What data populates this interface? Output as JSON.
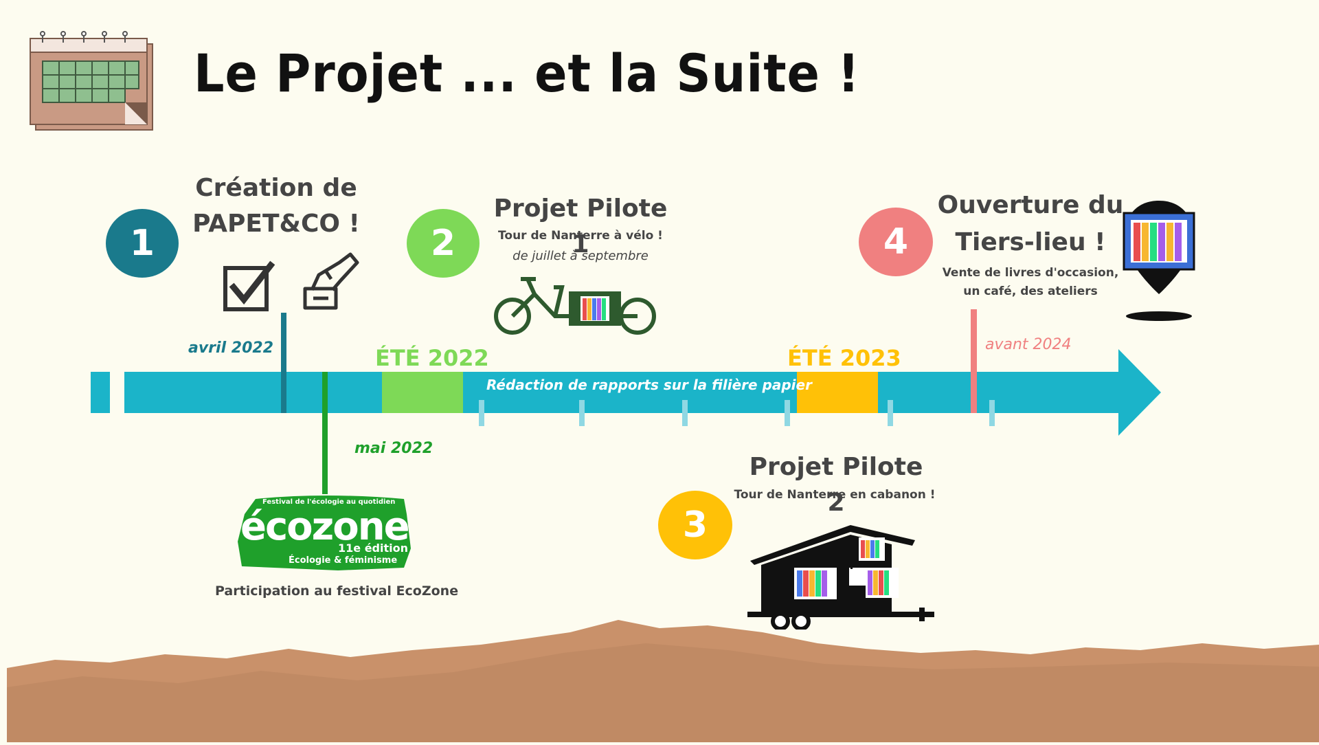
{
  "colors": {
    "background": "#fdfcf0",
    "timeline": "#1bb4c9",
    "step1": "#1a7a8c",
    "step2": "#7ed957",
    "step3": "#ffc107",
    "step4": "#f08080",
    "ecozone": "#1fa02b",
    "paper": "#c9916a"
  },
  "title": "Le Projet ... et la Suite !",
  "steps": [
    {
      "number": "1",
      "title_line1": "Création de",
      "title_line2": "PAPET&CO !",
      "date": "avril 2022",
      "icons": [
        "checkbox-icon",
        "signing-hand-icon"
      ]
    },
    {
      "number": "2",
      "title": "Projet Pilote 1",
      "subtitle": "Tour de Nanterre à vélo !",
      "detail": "de juillet à septembre",
      "icon": "cargo-bike-icon"
    },
    {
      "number": "3",
      "title": "Projet Pilote 2",
      "subtitle": "Tour de Nanterre en cabanon !",
      "icon": "tiny-house-icon"
    },
    {
      "number": "4",
      "title_line1": "Ouverture du",
      "title_line2": "Tiers-lieu !",
      "subtitle_line1": "Vente de livres d'occasion,",
      "subtitle_line2": "un café, des ateliers",
      "date": "avant 2024",
      "icon": "map-pin-bookshelf-icon"
    }
  ],
  "timeline": {
    "season1": "ÉTÉ 2022",
    "season2": "ÉTÉ 2023",
    "middle_text": "Rédaction de rapports sur la filière papier"
  },
  "ecozone": {
    "date": "mai 2022",
    "logo_top": "Festival de l'écologie au quotidien",
    "logo_name": "écozone",
    "logo_edition": "11e édition",
    "logo_theme": "Écologie & féminisme",
    "caption": "Participation au festival EcoZone"
  }
}
